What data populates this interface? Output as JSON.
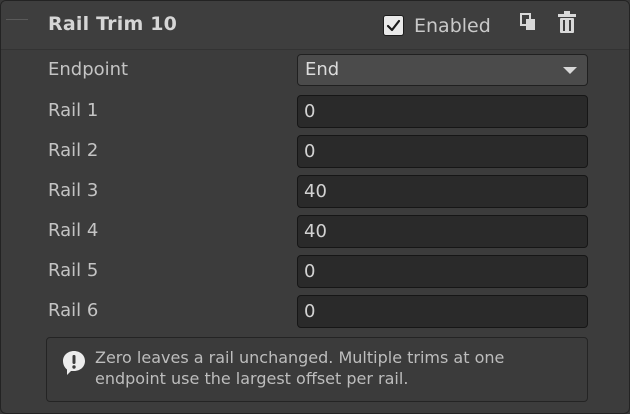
{
  "header": {
    "title": "Rail Trim 10",
    "enabled_label": "Enabled",
    "enabled_checked": true,
    "copy_icon": "copy-icon",
    "delete_icon": "trash-icon"
  },
  "fields": {
    "endpoint": {
      "label": "Endpoint",
      "value": "End"
    },
    "rail1": {
      "label": "Rail 1",
      "value": "0"
    },
    "rail2": {
      "label": "Rail 2",
      "value": "0"
    },
    "rail3": {
      "label": "Rail 3",
      "value": "40"
    },
    "rail4": {
      "label": "Rail 4",
      "value": "40"
    },
    "rail5": {
      "label": "Rail 5",
      "value": "0"
    },
    "rail6": {
      "label": "Rail 6",
      "value": "0"
    }
  },
  "help": {
    "icon": "info-speech-bubble-icon",
    "text": "Zero leaves a rail unchanged. Multiple trims at one endpoint use the largest offset per rail."
  }
}
